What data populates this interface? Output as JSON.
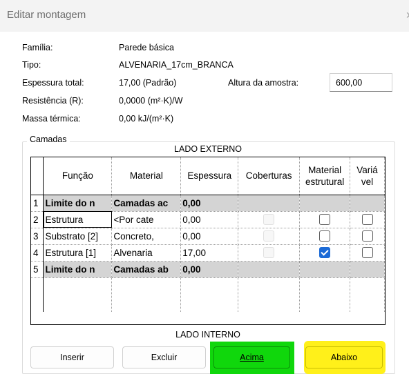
{
  "window": {
    "title": "Editar montagem",
    "close_glyph": "›"
  },
  "properties": {
    "family_label": "Família:",
    "family_value": "Parede básica",
    "type_label": "Tipo:",
    "type_value": "ALVENARIA_17cm_BRANCA",
    "thickness_label": "Espessura total:",
    "thickness_value": "17,00 (Padrão)",
    "resistance_label": "Resistência (R):",
    "resistance_value": "0,0000 (m²·K)/W",
    "mass_label": "Massa térmica:",
    "mass_value": "0,00 kJ/(m²·K)",
    "sample_height_label": "Altura da amostra:",
    "sample_height_value": "600,00"
  },
  "layers": {
    "group_title": "Camadas",
    "exterior_label": "LADO EXTERNO",
    "interior_label": "LADO INTERNO",
    "columns": [
      "",
      "Função",
      "Material",
      "Espessura",
      "Coberturas",
      "Material estrutural",
      "Variá vel"
    ],
    "rows": [
      {
        "num": "1",
        "function": "Limite do n",
        "material": "Camadas ac",
        "thickness": "0,00"
      },
      {
        "num": "2",
        "function": "Estrutura",
        "material": "<Por cate",
        "thickness": "0,00",
        "wraps": false,
        "structural": false,
        "variable": false
      },
      {
        "num": "3",
        "function": "Substrato [2]",
        "material": "Concreto,",
        "thickness": "0,00",
        "wraps": false,
        "structural": false,
        "variable": false
      },
      {
        "num": "4",
        "function": "Estrutura [1]",
        "material": "Alvenaria",
        "thickness": "17,00",
        "wraps": false,
        "structural": true,
        "variable": false
      },
      {
        "num": "5",
        "function": "Limite do n",
        "material": "Camadas ab",
        "thickness": "0,00"
      }
    ]
  },
  "buttons": {
    "insert": "Inserir",
    "delete": "Excluir",
    "up": "Acima",
    "down": "Abaixo"
  },
  "colors": {
    "highlight_up": "#10d70c",
    "highlight_down": "#fff01a",
    "checkbox_checked": "#1c6ad6"
  }
}
